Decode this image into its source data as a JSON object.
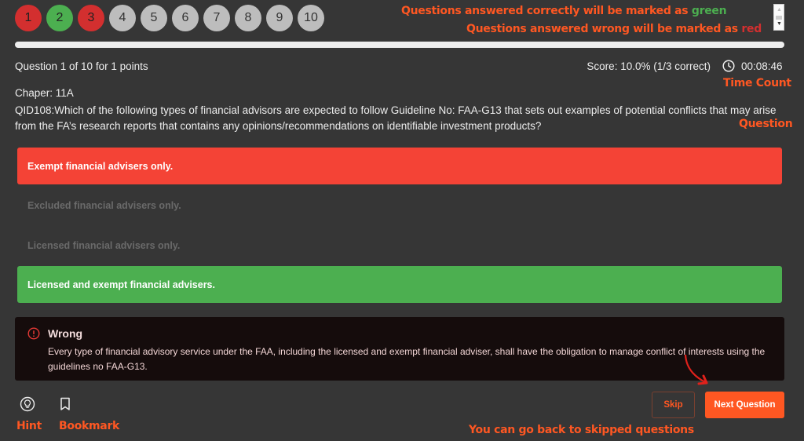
{
  "question_nav": [
    {
      "label": "1",
      "status": "wrong"
    },
    {
      "label": "2",
      "status": "correct"
    },
    {
      "label": "3",
      "status": "wrong"
    },
    {
      "label": "4",
      "status": "unanswered"
    },
    {
      "label": "5",
      "status": "unanswered"
    },
    {
      "label": "6",
      "status": "unanswered"
    },
    {
      "label": "7",
      "status": "unanswered"
    },
    {
      "label": "8",
      "status": "unanswered"
    },
    {
      "label": "9",
      "status": "unanswered"
    },
    {
      "label": "10",
      "status": "unanswered"
    }
  ],
  "annotations": {
    "correct_prefix": "Questions answered correctly will be marked as ",
    "correct_color_word": "green",
    "wrong_prefix": "Questions answered wrong will be marked as ",
    "wrong_color_word": "red",
    "time_count": "Time Count",
    "question": "Question",
    "hint": "Hint",
    "bookmark": "Bookmark",
    "skip_note": "You can go back to skipped questions"
  },
  "progress": {
    "percent": 100
  },
  "header": {
    "question_info": "Question 1 of 10 for 1 points",
    "score": "Score: 10.0% (1/3 correct)",
    "timer": "00:08:46"
  },
  "question": {
    "chapter": "Chaper: 11A",
    "text": "QID108:Which of the following types of financial advisors are expected to follow Guideline No: FAA-G13 that sets out examples of potential conflicts that may arise from the FA’s research reports that contains any opinions/recommendations on identifiable investment products?"
  },
  "options": [
    {
      "label": "Exempt financial advisers only.",
      "state": "wrong"
    },
    {
      "label": "Excluded financial advisers only.",
      "state": "neutral"
    },
    {
      "label": "Licensed financial advisers only.",
      "state": "neutral"
    },
    {
      "label": "Licensed and exempt financial advisers.",
      "state": "correct"
    }
  ],
  "feedback": {
    "title": "Wrong",
    "body": "Every type of financial advisory service under the FAA, including the licensed and exempt financial adviser, shall have the obligation to manage conflict of interests using the guidelines no FAA-G13."
  },
  "actions": {
    "skip": "Skip",
    "next": "Next Question"
  },
  "colors": {
    "accent": "#ff5722",
    "correct": "#4caf50",
    "wrong": "#f44336",
    "background": "#363636"
  }
}
